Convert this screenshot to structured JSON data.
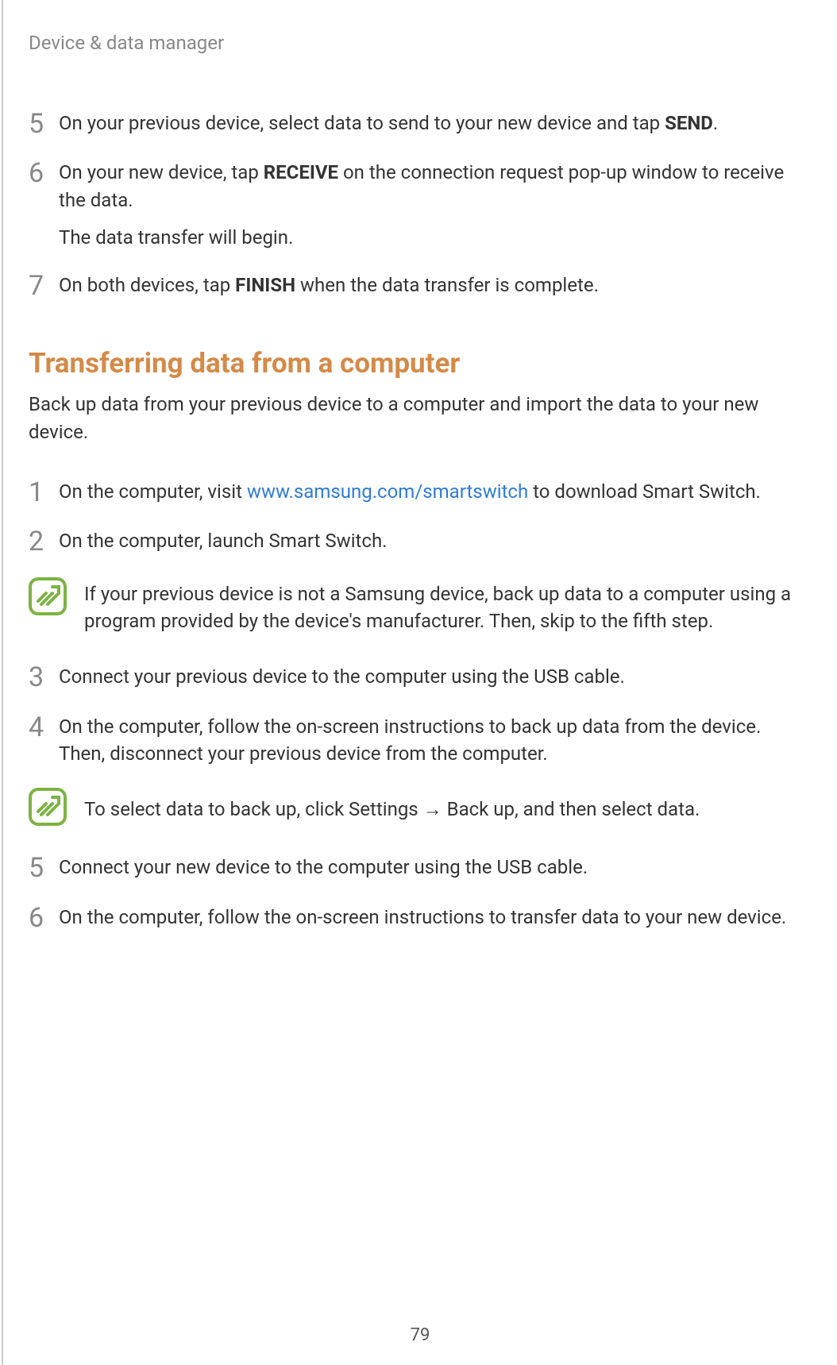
{
  "header": "Device & data manager",
  "steps_top": {
    "s5": {
      "num": "5",
      "text_before": "On your previous device, select data to send to your new device and tap ",
      "bold": "SEND",
      "text_after": "."
    },
    "s6": {
      "num": "6",
      "text_before": "On your new device, tap ",
      "bold": "RECEIVE",
      "text_after": " on the connection request pop-up window to receive the data.",
      "subtext": "The data transfer will begin."
    },
    "s7": {
      "num": "7",
      "text_before": "On both devices, tap ",
      "bold": "FINISH",
      "text_after": " when the data transfer is complete."
    }
  },
  "section": {
    "heading": "Transferring data from a computer",
    "intro": "Back up data from your previous device to a computer and import the data to your new device."
  },
  "steps_bottom": {
    "s1": {
      "num": "1",
      "text_before": "On the computer, visit ",
      "link": "www.samsung.com/smartswitch",
      "text_after": " to download Smart Switch."
    },
    "s2": {
      "num": "2",
      "text": "On the computer, launch Smart Switch."
    },
    "s3": {
      "num": "3",
      "text": "Connect your previous device to the computer using the USB cable."
    },
    "s4": {
      "num": "4",
      "text": "On the computer, follow the on-screen instructions to back up data from the device. Then, disconnect your previous device from the computer."
    },
    "s5": {
      "num": "5",
      "text": "Connect your new device to the computer using the USB cable."
    },
    "s6": {
      "num": "6",
      "text": "On the computer, follow the on-screen instructions to transfer data to your new device."
    }
  },
  "notes": {
    "note1": "If your previous device is not a Samsung device, back up data to a computer using a program provided by the device's manufacturer. Then, skip to the fifth step.",
    "note2_before": "To select data to back up, click Settings ",
    "note2_arrow": "→",
    "note2_after": " Back up, and then select data."
  },
  "page_number": "79"
}
